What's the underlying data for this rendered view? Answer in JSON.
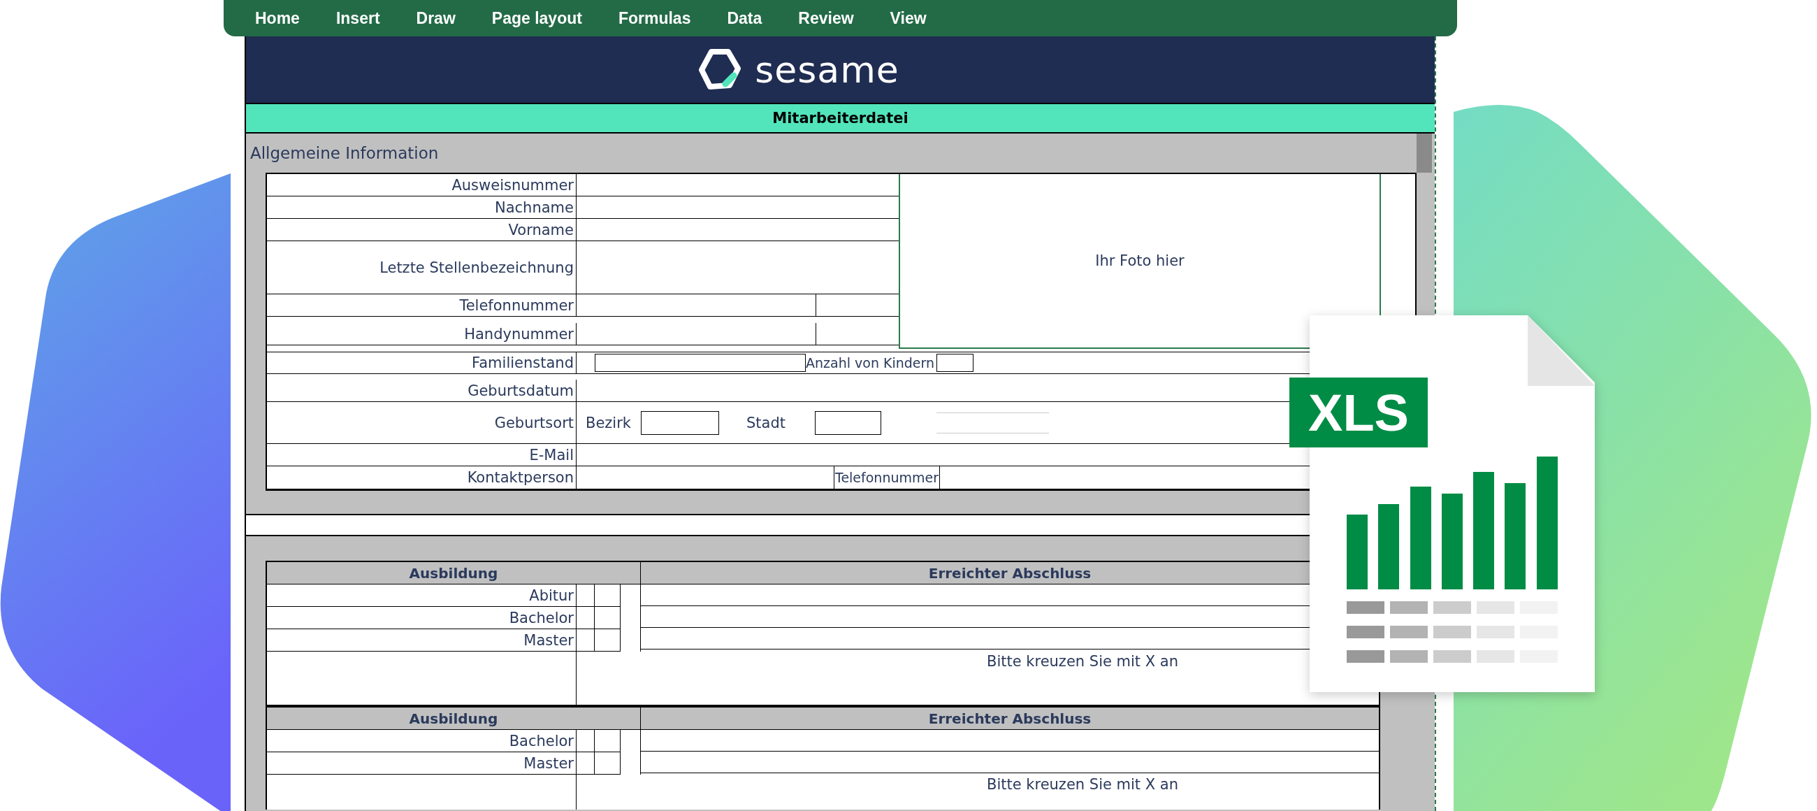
{
  "menu": [
    {
      "label": "Home"
    },
    {
      "label": "Insert"
    },
    {
      "label": "Draw"
    },
    {
      "label": "Page layout"
    },
    {
      "label": "Formulas"
    },
    {
      "label": "Data"
    },
    {
      "label": "Review"
    },
    {
      "label": "View"
    }
  ],
  "header": {
    "logo_text": "sesame"
  },
  "title_bar": "Mitarbeiterdatei",
  "general": {
    "title": "Allgemeine Information",
    "photo_placeholder": "Ihr Foto hier",
    "rows_beside_photo": [
      {
        "kind": "field",
        "label": "Ausweisnummer"
      },
      {
        "kind": "field",
        "label": "Nachname"
      },
      {
        "kind": "field",
        "label": "Vorname"
      },
      {
        "kind": "tall",
        "label": "Letzte Stellenbezeichnung"
      },
      {
        "kind": "short",
        "label": "Telefonnummer"
      },
      {
        "kind": "short",
        "label": "Handynummer"
      }
    ],
    "rows": [
      {
        "kind": "family",
        "label": "Familienstand",
        "extra_label": "Anzahl von Kindern"
      },
      {
        "kind": "field",
        "label": "Geburtsdatum"
      },
      {
        "kind": "birthplace",
        "label": "Geburtsort",
        "parts": [
          "Bezirk",
          "Stadt"
        ]
      },
      {
        "kind": "field",
        "label": "E-Mail"
      },
      {
        "kind": "contact",
        "label": "Kontaktperson",
        "extra_label": "Telefonnummer"
      }
    ]
  },
  "education": [
    {
      "headers": [
        "Ausbildung",
        "Erreichter Abschluss"
      ],
      "rows": [
        "Abitur",
        "Bachelor",
        "Master"
      ],
      "note": "Bitte kreuzen Sie mit X an"
    },
    {
      "headers": [
        "Ausbildung",
        "Erreichter Abschluss"
      ],
      "rows": [
        "Bachelor",
        "Master"
      ],
      "note": "Bitte kreuzen Sie mit X an"
    }
  ],
  "file_icon": {
    "badge": "XLS"
  }
}
